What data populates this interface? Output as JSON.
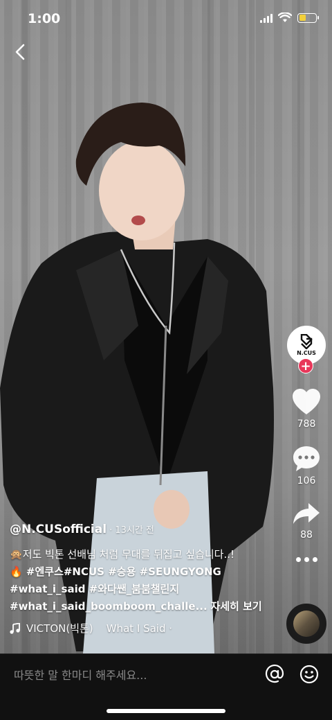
{
  "status_bar": {
    "time": "1:00",
    "battery_level": 0.4,
    "battery_color": "#f3d03a"
  },
  "nav": {
    "back_icon": "chevron-left-icon"
  },
  "creator": {
    "avatar_text": "N.CUS",
    "follow_icon": "plus-icon"
  },
  "actions": {
    "like_count": "788",
    "comment_count": "106",
    "share_count": "88",
    "more_icon": "ellipsis-icon"
  },
  "caption": {
    "username": "@N.CUSofficial",
    "time_ago": "· 13시간 전",
    "line1": "🙊저도 빅톤 선배님 처럼 무대를 뒤집고 싶습니다..!",
    "line2": "🔥 #엔쿠스#NCUS #승용 #SEUNGYONG",
    "line3": "#what_i_said #와다쌘_붐붐챌린지",
    "line4": "#what_i_said_boomboom_challe...",
    "see_more": "자세히 보기"
  },
  "sound": {
    "text": "VICTON(빅톤)    What I Said ·"
  },
  "comment_bar": {
    "placeholder": "따뜻한 말 한마디 해주세요..."
  },
  "colors": {
    "accent_follow": "#e8375a"
  }
}
